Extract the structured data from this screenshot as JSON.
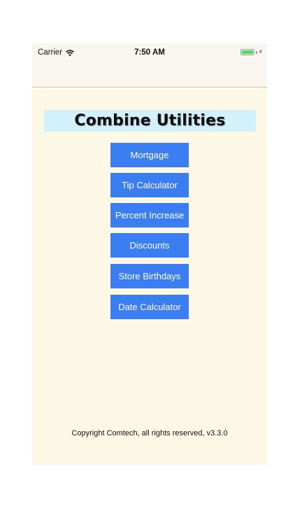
{
  "status_bar": {
    "carrier": "Carrier",
    "time": "7:50 AM",
    "wifi_icon": "wifi-icon",
    "battery_icon": "battery-icon",
    "charging_icon": "bolt-icon",
    "battery_level": 1.0,
    "battery_color": "#4cd964"
  },
  "header": {
    "title": "Combine Utilities"
  },
  "menu": {
    "items": [
      {
        "label": "Mortgage"
      },
      {
        "label": "Tip Calculator"
      },
      {
        "label": "Percent Increase"
      },
      {
        "label": "Discounts"
      },
      {
        "label": "Store Birthdays"
      },
      {
        "label": "Date Calculator"
      }
    ]
  },
  "footer": {
    "copyright": "Copyright Comtech, all rights reserved, v3.3.0"
  },
  "colors": {
    "background": "#fdf8e6",
    "banner": "#d3f1fb",
    "button": "#3b7ef2",
    "button_text": "#ffffff"
  }
}
